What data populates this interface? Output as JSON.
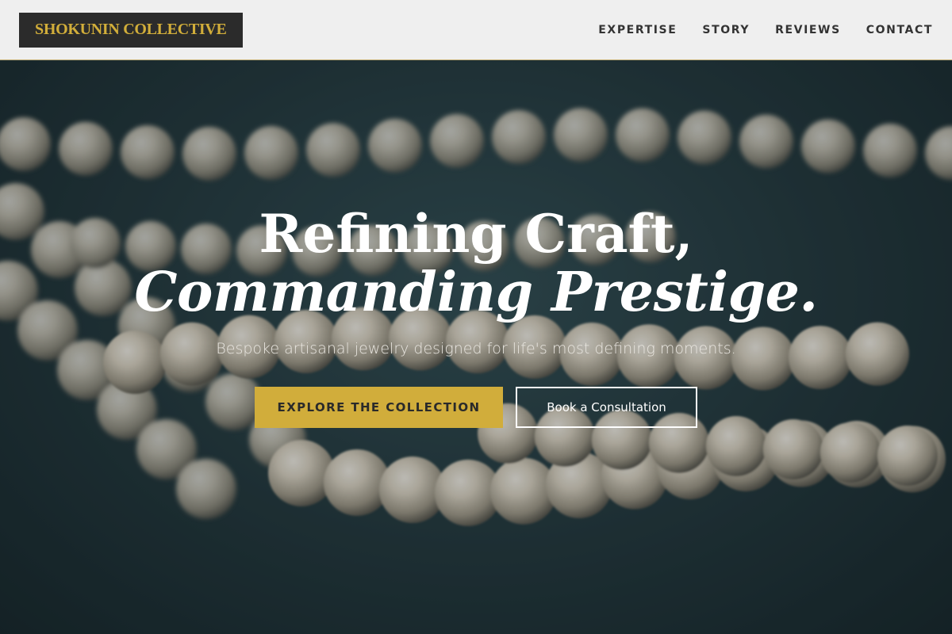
{
  "brand": {
    "name": "SHOKUNIN COLLECTIVE"
  },
  "nav": {
    "items": [
      {
        "label": "EXPERTISE"
      },
      {
        "label": "STORY"
      },
      {
        "label": "REVIEWS"
      },
      {
        "label": "CONTACT"
      }
    ]
  },
  "hero": {
    "headline_line1": "Refining Craft,",
    "headline_line2": "Commanding Prestige.",
    "subtitle": "Bespoke artisanal jewelry designed for life's most defining moments.",
    "primary_cta": "EXPLORE THE COLLECTION",
    "secondary_cta": "Book a Consultation",
    "background_image": "pearl-necklace-photo"
  },
  "colors": {
    "accent_gold": "#d1ad3b",
    "header_bg": "#efefef",
    "logo_bg": "#2b2b2b"
  }
}
